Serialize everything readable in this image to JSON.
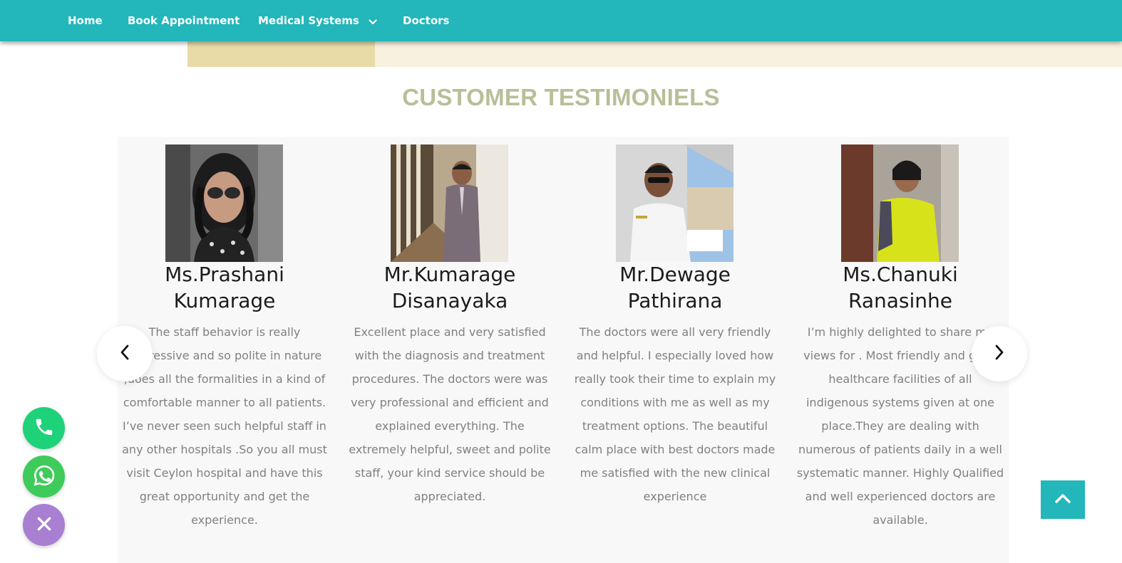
{
  "nav": {
    "items": [
      {
        "label": "Home"
      },
      {
        "label": "Book Appointment"
      },
      {
        "label": "Medical Systems",
        "icon": "chevron-down-icon"
      },
      {
        "label": "Doctors"
      }
    ]
  },
  "colors": {
    "nav_bg": "#23b6ba",
    "title": "#b7bf98",
    "band_left": "#e8dba8",
    "band_right": "#f9f1df",
    "phone_fab": "#1ed27a",
    "whatsapp_fab": "#3ecb5a",
    "close_fab": "#a87fd1",
    "back_top": "#23b6ba"
  },
  "section": {
    "title": "CUSTOMER TESTIMONIELS"
  },
  "testimonials": [
    {
      "name_line1": "Ms.Prashani",
      "name_line2": "Kumarage",
      "quote": "The staff behavior is really impressive and so polite in nature ,does all the formalities in a kind of comfortable manner to all patients. I’ve never seen such helpful staff in any other hospitals .So you all must visit Ceylon hospital and have this great opportunity and get the experience."
    },
    {
      "name_line1": "Mr.Kumarage",
      "name_line2": "Disanayaka",
      "quote": "Excellent place and very satisfied with the diagnosis and treatment procedures. The doctors were was very professional and efficient and explained everything. The extremely helpful, sweet and polite staff, your kind service should be appreciated."
    },
    {
      "name_line1": "Mr.Dewage",
      "name_line2": "Pathirana",
      "quote": "The doctors were all very friendly and helpful. I especially loved how really took their time to explain my conditions with me as well as my treatment options. The beautiful calm place with best doctors made me satisfied with the new clinical experience"
    },
    {
      "name_line1": "Ms.Chanuki",
      "name_line2": "Ranasinhe",
      "quote": "I’m highly delighted to share my views for . Most friendly and good healthcare facilities of all indigenous systems given at one place.They are dealing with numerous of patients daily in a well systematic manner. Highly Qualified and well experienced doctors are available."
    }
  ],
  "carousel": {
    "prev_icon": "chevron-left-icon",
    "next_icon": "chevron-right-icon"
  },
  "floating": {
    "phone_icon": "phone-icon",
    "whatsapp_icon": "whatsapp-icon",
    "close_icon": "close-icon",
    "back_to_top_icon": "chevron-up-icon"
  }
}
